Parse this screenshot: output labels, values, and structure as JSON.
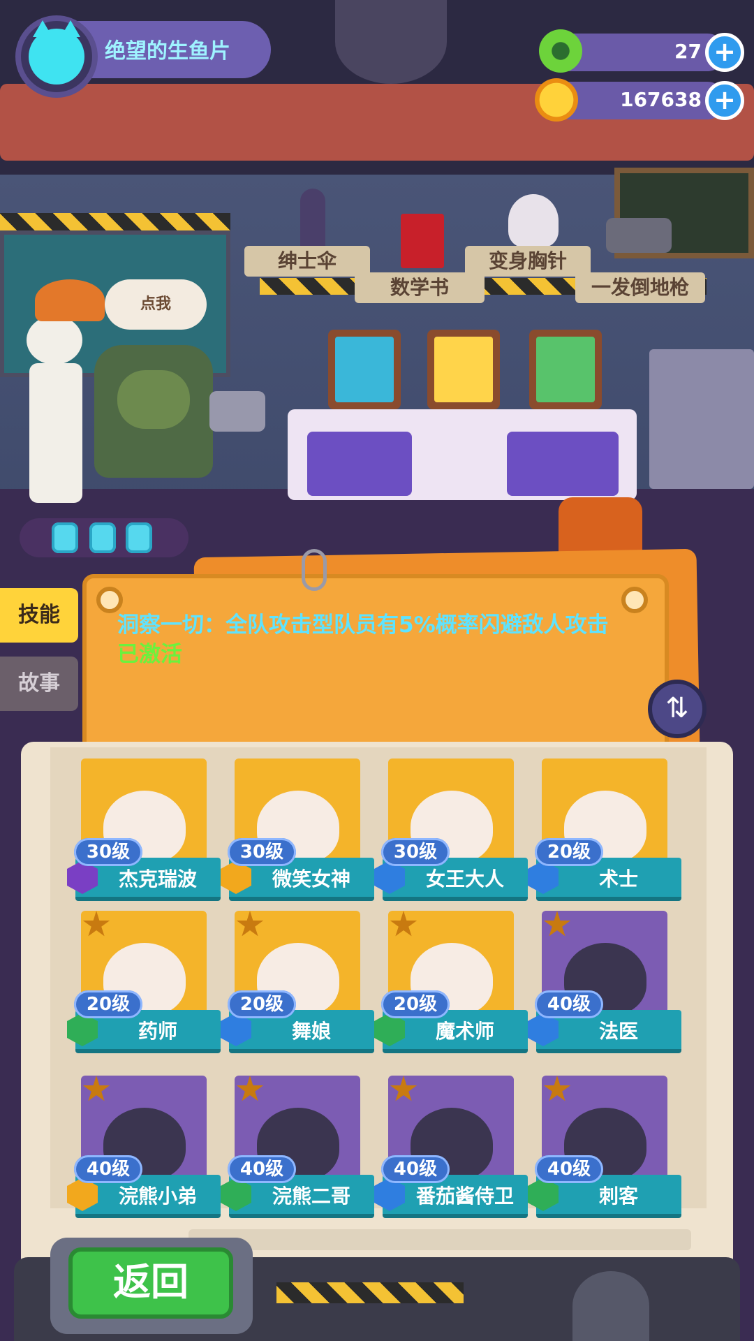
{
  "player": {
    "name": "绝望的生鱼片"
  },
  "currency": {
    "gems": {
      "value": "27",
      "icon": "green-donut-icon"
    },
    "coins": {
      "value": "167638",
      "icon": "gold-planet-coin-icon"
    }
  },
  "lab_items": [
    {
      "label": "绅士伞",
      "icon": "umbrella-icon"
    },
    {
      "label": "数学书",
      "icon": "book-icon"
    },
    {
      "label": "变身胸针",
      "icon": "skull-icon"
    },
    {
      "label": "一发倒地枪",
      "icon": "gun-icon"
    }
  ],
  "speech_bubble": "点我",
  "charges": {
    "count": 3,
    "icon": "lightning-charge-icon"
  },
  "side_tabs": {
    "skill": "技能",
    "story": "故事"
  },
  "skill": {
    "text": "洞察一切：全队攻击型队员有5%概率闪避敌人攻击",
    "status": "已激活"
  },
  "colors": {
    "accent_cyan": "#5ee3ff",
    "active_green": "#6bf23d",
    "plate_teal": "#1fa0b2"
  },
  "characters": [
    {
      "name": "杰克瑞波",
      "level": "30级",
      "role_color": "#7a3fc4",
      "bg": "gold",
      "star": false
    },
    {
      "name": "微笑女神",
      "level": "30级",
      "role_color": "#f2a81d",
      "bg": "gold",
      "star": false
    },
    {
      "name": "女王大人",
      "level": "30级",
      "role_color": "#2f7ee0",
      "bg": "gold",
      "star": false
    },
    {
      "name": "术士",
      "level": "20级",
      "role_color": "#2f7ee0",
      "bg": "gold",
      "star": false
    },
    {
      "name": "药师",
      "level": "20级",
      "role_color": "#2fae57",
      "bg": "gold",
      "star": true
    },
    {
      "name": "舞娘",
      "level": "20级",
      "role_color": "#2f7ee0",
      "bg": "gold",
      "star": true
    },
    {
      "name": "魔术师",
      "level": "20级",
      "role_color": "#2fae57",
      "bg": "gold",
      "star": true
    },
    {
      "name": "法医",
      "level": "40级",
      "role_color": "#2f7ee0",
      "bg": "purple",
      "star": true
    },
    {
      "name": "浣熊小弟",
      "level": "40级",
      "role_color": "#f2a81d",
      "bg": "purple",
      "star": true
    },
    {
      "name": "浣熊二哥",
      "level": "40级",
      "role_color": "#2fae57",
      "bg": "purple",
      "star": true
    },
    {
      "name": "番茄酱侍卫",
      "level": "40级",
      "role_color": "#2f7ee0",
      "bg": "purple",
      "star": true
    },
    {
      "name": "刺客",
      "level": "40级",
      "role_color": "#2fae57",
      "bg": "purple",
      "star": true
    }
  ],
  "back_button": "返回"
}
